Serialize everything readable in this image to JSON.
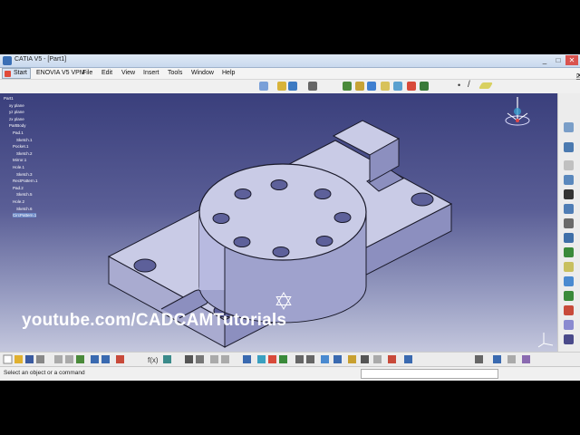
{
  "window": {
    "title": "CATIA V5 - [Part1]",
    "controls": [
      "_",
      "□",
      "✕"
    ],
    "doc_controls": [
      "_",
      "□",
      "✕"
    ]
  },
  "menu": {
    "start": "Start",
    "items": [
      "ENOVIA V5 VPM",
      "File",
      "Edit",
      "View",
      "Insert",
      "Tools",
      "Window",
      "Help"
    ]
  },
  "tree": {
    "root": "Part1",
    "planes": [
      "xy plane",
      "yz plane",
      "zx plane"
    ],
    "body": "PartBody",
    "features": [
      {
        "label": "Pad.1",
        "child": "Sketch.1"
      },
      {
        "label": "Pocket.1",
        "child": "Sketch.2"
      },
      {
        "label": "Mirror.1",
        "child": ""
      },
      {
        "label": "Hole.1",
        "child": "Sketch.3"
      },
      {
        "label": "RectPattern.1",
        "child": ""
      },
      {
        "label": "Pad.2",
        "child": "Sketch.5"
      },
      {
        "label": "Hole.2",
        "child": "Sketch.6"
      },
      {
        "label": "CircPattern.1",
        "child": ""
      }
    ]
  },
  "watermark": "youtube.com/CADCAMTutorials",
  "status": {
    "message": "Select an object or a command"
  },
  "colors": {
    "viewport_top": "#3a3f7c",
    "viewport_bottom": "#c4c7dd",
    "part_face": "#c9cbe6",
    "part_edge": "#1a1a2a"
  },
  "icons": {
    "toolbar_top": [
      "fly-icon",
      "pan-icon",
      "rotate-icon",
      "zoom-icon",
      "fit-all-icon",
      "normal-view-icon",
      "shading-icon",
      "hide-show-icon",
      "swap-icon",
      "isometric-icon",
      "point-icon",
      "line-icon",
      "plane-icon"
    ],
    "toolbar_right": [
      "sketcher-icon",
      "pad-icon",
      "pocket-icon",
      "shaft-icon",
      "groove-icon",
      "hole-icon",
      "rib-icon",
      "slot-icon",
      "stiffener-icon",
      "loft-icon",
      "fillet-icon",
      "chamfer-icon",
      "draft-icon",
      "shell-icon",
      "thickness-icon",
      "thread-icon",
      "mirror-icon",
      "pattern-icon",
      "scaling-icon",
      "measure-icon"
    ],
    "toolbar_bottom": [
      "new-icon",
      "open-icon",
      "save-icon",
      "print-icon",
      "cut-icon",
      "copy-icon",
      "paste-icon",
      "undo-icon",
      "redo-icon",
      "help-icon",
      "formula-icon",
      "law-icon",
      "table-icon",
      "catalog-icon",
      "snap-icon",
      "axis-icon",
      "grid-icon",
      "pan-icon",
      "rotate-icon",
      "zoom-in-icon",
      "zoom-out-icon",
      "normal-view-icon",
      "views-icon",
      "render-icon",
      "hide-icon",
      "swap-icon",
      "apply-material-icon",
      "measure-icon",
      "analysis-icon"
    ]
  }
}
